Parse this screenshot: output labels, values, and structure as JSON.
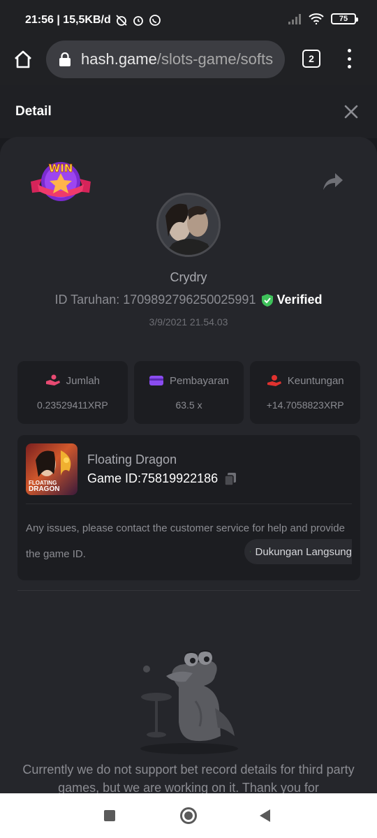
{
  "status_bar": {
    "time_info": "21:56 | 15,5KB/d",
    "battery": "75"
  },
  "browser": {
    "url_host": "hash.game",
    "url_path": "/slots-game/softs",
    "tab_count": "2"
  },
  "header": {
    "title": "Detail"
  },
  "badge": {
    "text": "WIN"
  },
  "player": {
    "name": "Crydry",
    "bet_id_label": "ID Taruhan:",
    "bet_id": "1709892796250025991",
    "verified_label": "Verified",
    "date": "3/9/2021 21.54.03"
  },
  "stats": [
    {
      "icon": "bet-hand-icon",
      "label": "Jumlah",
      "value": "0.23529411XRP"
    },
    {
      "icon": "wallet-icon",
      "label": "Pembayaran",
      "value": "63.5 x"
    },
    {
      "icon": "profit-hand-icon",
      "label": "Keuntungan",
      "value": "+14.7058823XRP"
    }
  ],
  "game": {
    "name": "Floating Dragon",
    "id_label": "Game ID:",
    "id": "75819922186",
    "thumb_line1": "FLOATING",
    "thumb_line2": "DRAGON",
    "notice": "Any issues, please contact the customer service for help and provide the game ID.",
    "support_label": "Dukungan Langsung"
  },
  "empty_state": {
    "message": "Currently we do not support bet record details for third party games, but we are working on it. Thank you for"
  },
  "colors": {
    "background": "#1a1b1f",
    "panel": "#25262b",
    "card": "#1c1d21",
    "verified_green": "#3ec15a",
    "bet_icon": "#e84a72",
    "wallet_icon": "#8a4cf0",
    "profit_icon": "#e0322f"
  }
}
